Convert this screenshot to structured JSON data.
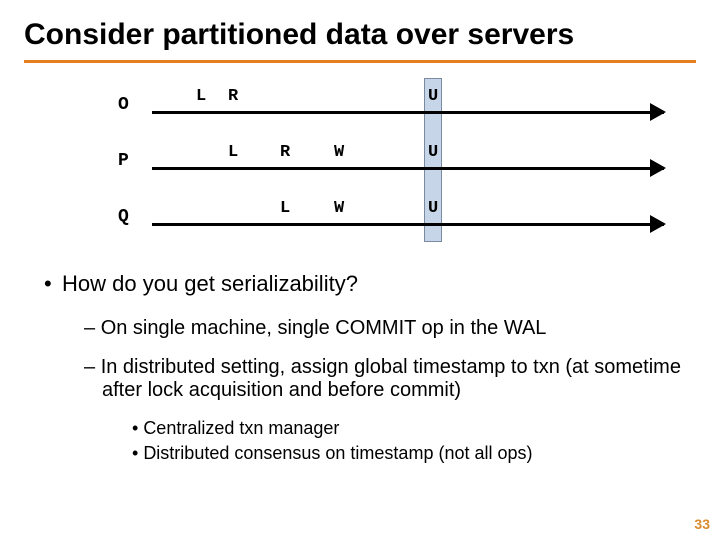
{
  "title": "Consider partitioned data over servers",
  "servers": {
    "o": "O",
    "p": "P",
    "q": "Q"
  },
  "events": {
    "o": {
      "L": "L",
      "R": "R",
      "U": "U"
    },
    "p": {
      "L": "L",
      "R": "R",
      "W": "W",
      "U": "U"
    },
    "q": {
      "L": "L",
      "W": "W",
      "U": "U"
    }
  },
  "bullets": {
    "l1": "How do you get serializability?",
    "l2a": "On single machine, single COMMIT op in the WAL",
    "l2b": "In distributed setting, assign global timestamp to txn (at sometime after lock acquisition and before commit)",
    "l3a": "Centralized txn manager",
    "l3b": "Distributed consensus on timestamp (not all ops)"
  },
  "page_number": "33"
}
